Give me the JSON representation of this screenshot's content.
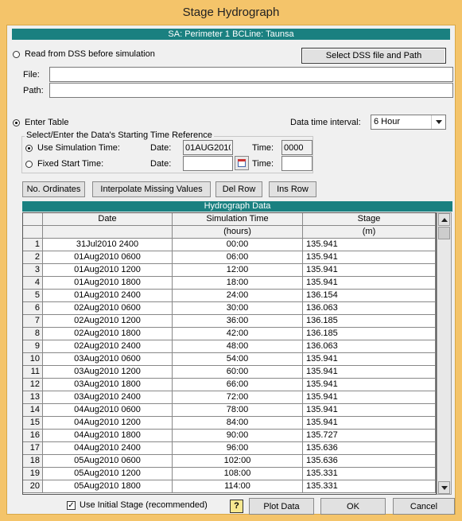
{
  "window": {
    "title": "Stage Hydrograph"
  },
  "header": {
    "sa_label": "SA: Perimeter 1 BCLine: Taunsa"
  },
  "dss": {
    "radio_label": "Read from DSS before simulation",
    "select_button": "Select DSS file and Path",
    "file_label": "File:",
    "file_value": "",
    "path_label": "Path:",
    "path_value": ""
  },
  "table": {
    "radio_label": "Enter Table",
    "interval_label": "Data time interval:",
    "interval_value": "6 Hour"
  },
  "timeref": {
    "legend": "Select/Enter the Data's Starting Time Reference",
    "use_sim_label": "Use Simulation Time:",
    "fixed_label": "Fixed Start Time:",
    "date_label": "Date:",
    "time_label": "Time:",
    "sim_date": "01AUG2010",
    "sim_time": "0000",
    "fixed_date": "",
    "fixed_time": ""
  },
  "toolbar": {
    "ordinates": "No. Ordinates",
    "interpolate": "Interpolate Missing Values",
    "del_row": "Del Row",
    "ins_row": "Ins Row"
  },
  "grid": {
    "title": "Hydrograph Data",
    "col_date": "Date",
    "col_time": "Simulation Time",
    "col_stage": "Stage",
    "unit_time": "(hours)",
    "unit_stage": "(m)",
    "rows": [
      {
        "n": "1",
        "date": "31Jul2010 2400",
        "time": "00:00",
        "stage": "135.941"
      },
      {
        "n": "2",
        "date": "01Aug2010 0600",
        "time": "06:00",
        "stage": "135.941"
      },
      {
        "n": "3",
        "date": "01Aug2010 1200",
        "time": "12:00",
        "stage": "135.941"
      },
      {
        "n": "4",
        "date": "01Aug2010 1800",
        "time": "18:00",
        "stage": "135.941"
      },
      {
        "n": "5",
        "date": "01Aug2010 2400",
        "time": "24:00",
        "stage": "136.154"
      },
      {
        "n": "6",
        "date": "02Aug2010 0600",
        "time": "30:00",
        "stage": "136.063"
      },
      {
        "n": "7",
        "date": "02Aug2010 1200",
        "time": "36:00",
        "stage": "136.185"
      },
      {
        "n": "8",
        "date": "02Aug2010 1800",
        "time": "42:00",
        "stage": "136.185"
      },
      {
        "n": "9",
        "date": "02Aug2010 2400",
        "time": "48:00",
        "stage": "136.063"
      },
      {
        "n": "10",
        "date": "03Aug2010 0600",
        "time": "54:00",
        "stage": "135.941"
      },
      {
        "n": "11",
        "date": "03Aug2010 1200",
        "time": "60:00",
        "stage": "135.941"
      },
      {
        "n": "12",
        "date": "03Aug2010 1800",
        "time": "66:00",
        "stage": "135.941"
      },
      {
        "n": "13",
        "date": "03Aug2010 2400",
        "time": "72:00",
        "stage": "135.941"
      },
      {
        "n": "14",
        "date": "04Aug2010 0600",
        "time": "78:00",
        "stage": "135.941"
      },
      {
        "n": "15",
        "date": "04Aug2010 1200",
        "time": "84:00",
        "stage": "135.941"
      },
      {
        "n": "16",
        "date": "04Aug2010 1800",
        "time": "90:00",
        "stage": "135.727"
      },
      {
        "n": "17",
        "date": "04Aug2010 2400",
        "time": "96:00",
        "stage": "135.636"
      },
      {
        "n": "18",
        "date": "05Aug2010 0600",
        "time": "102:00",
        "stage": "135.636"
      },
      {
        "n": "19",
        "date": "05Aug2010 1200",
        "time": "108:00",
        "stage": "135.331"
      },
      {
        "n": "20",
        "date": "05Aug2010 1800",
        "time": "114:00",
        "stage": "135.331"
      }
    ]
  },
  "footer": {
    "initial_stage_label": "Use Initial Stage (recommended)",
    "help": "?",
    "plot": "Plot Data",
    "ok": "OK",
    "cancel": "Cancel"
  }
}
